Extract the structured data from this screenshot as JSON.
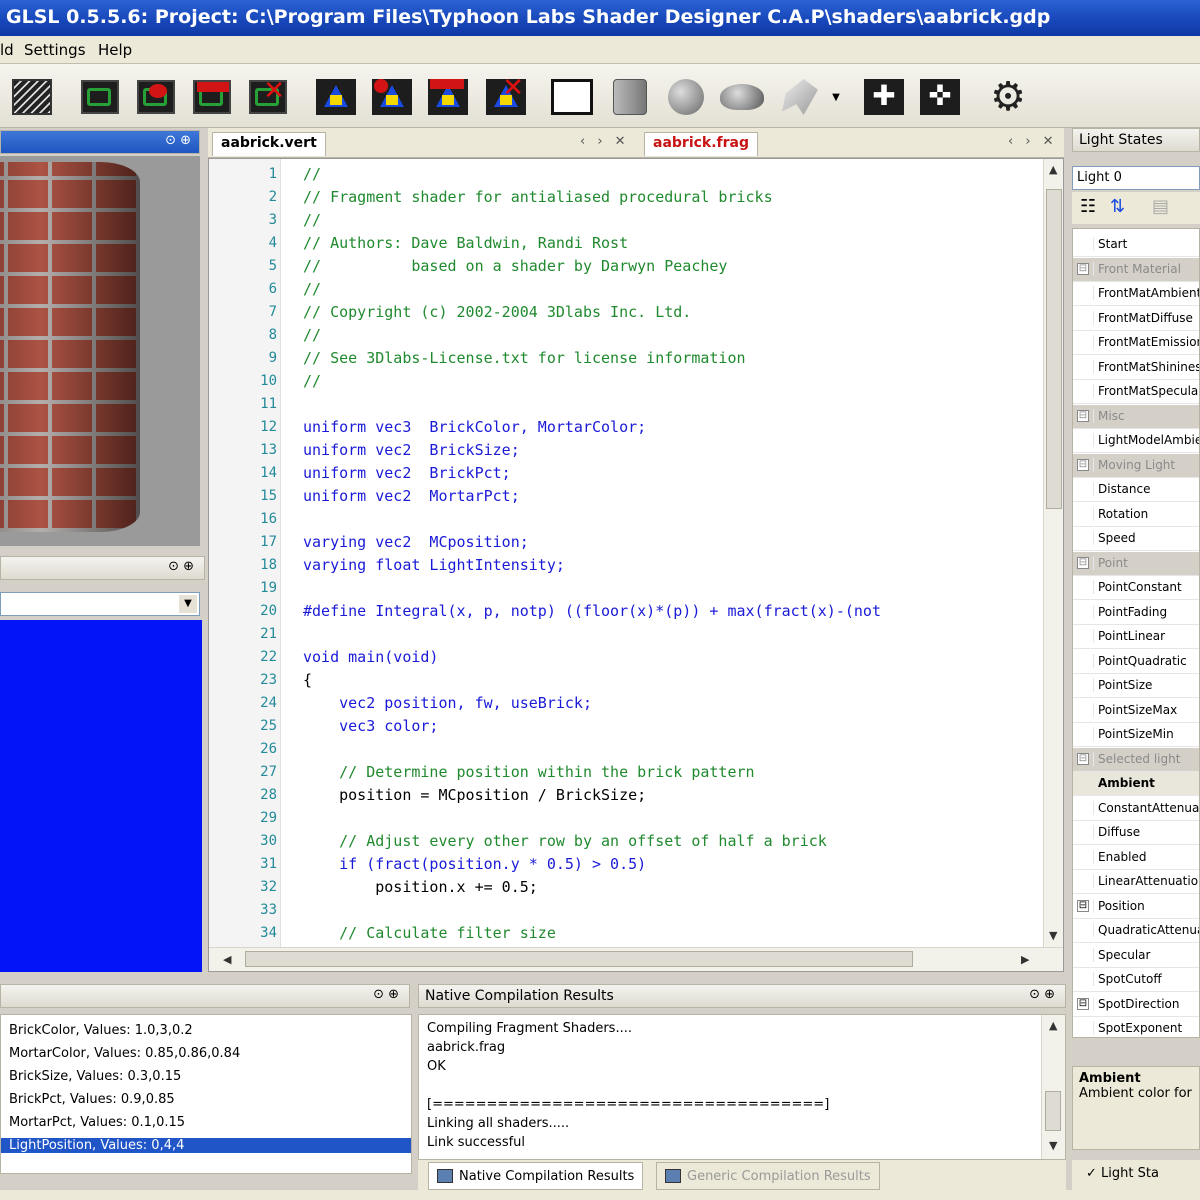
{
  "window": {
    "title": "GLSL 0.5.5.6: Project: C:\\Program Files\\Typhoon Labs Shader Designer C.A.P\\shaders\\aabrick.gdp"
  },
  "menu": {
    "items": [
      "ld",
      "Settings",
      "Help"
    ]
  },
  "toolbar": {
    "icons": [
      "wireframe-icon",
      "vertex-shader-icon",
      "add-vertex-shader-icon",
      "remove-vertex-shader-icon",
      "delete-vertex-shader-icon",
      "fragment-shader-icon",
      "add-fragment-shader-icon",
      "remove-fragment-shader-icon",
      "delete-fragment-shader-icon",
      "plane-icon",
      "cube-icon",
      "sphere-icon",
      "teapot-icon",
      "model-icon",
      "zoom-in-icon",
      "zoom-out-icon",
      "compile-gear-icon"
    ]
  },
  "editor": {
    "tabs": [
      {
        "label": "aabrick.vert",
        "active": false
      },
      {
        "label": "aabrick.frag",
        "active": true
      }
    ],
    "lines": [
      "//",
      "// Fragment shader for antialiased procedural bricks",
      "//",
      "// Authors: Dave Baldwin, Randi Rost",
      "//          based on a shader by Darwyn Peachey",
      "//",
      "// Copyright (c) 2002-2004 3Dlabs Inc. Ltd.",
      "//",
      "// See 3Dlabs-License.txt for license information",
      "//",
      "",
      "uniform vec3  BrickColor, MortarColor;",
      "uniform vec2  BrickSize;",
      "uniform vec2  BrickPct;",
      "uniform vec2  MortarPct;",
      "",
      "varying vec2  MCposition;",
      "varying float LightIntensity;",
      "",
      "#define Integral(x, p, notp) ((floor(x)*(p)) + max(fract(x)-(not",
      "",
      "void main(void)",
      "{",
      "    vec2 position, fw, useBrick;",
      "    vec3 color;",
      "",
      "    // Determine position within the brick pattern",
      "    position = MCposition / BrickSize;",
      "",
      "    // Adjust every other row by an offset of half a brick",
      "    if (fract(position.y * 0.5) > 0.5)",
      "        position.x += 0.5;",
      "",
      "    // Calculate filter size"
    ]
  },
  "light_panel": {
    "title": "Light States",
    "selected_light": "Light 0",
    "rows": [
      {
        "kind": "item",
        "label": "Start"
      },
      {
        "kind": "cat",
        "label": "Front Material"
      },
      {
        "kind": "item",
        "label": "FrontMatAmbient"
      },
      {
        "kind": "item",
        "label": "FrontMatDiffuse"
      },
      {
        "kind": "item",
        "label": "FrontMatEmission"
      },
      {
        "kind": "item",
        "label": "FrontMatShininess"
      },
      {
        "kind": "item",
        "label": "FrontMatSpecular"
      },
      {
        "kind": "cat",
        "label": "Misc"
      },
      {
        "kind": "item",
        "label": "LightModelAmbient"
      },
      {
        "kind": "cat",
        "label": "Moving Light"
      },
      {
        "kind": "item",
        "label": "Distance"
      },
      {
        "kind": "item",
        "label": "Rotation"
      },
      {
        "kind": "item",
        "label": "Speed"
      },
      {
        "kind": "cat",
        "label": "Point"
      },
      {
        "kind": "item",
        "label": "PointConstant"
      },
      {
        "kind": "item",
        "label": "PointFading"
      },
      {
        "kind": "item",
        "label": "PointLinear"
      },
      {
        "kind": "item",
        "label": "PointQuadratic"
      },
      {
        "kind": "item",
        "label": "PointSize"
      },
      {
        "kind": "item",
        "label": "PointSizeMax"
      },
      {
        "kind": "item",
        "label": "PointSizeMin"
      },
      {
        "kind": "cat",
        "label": "Selected light"
      },
      {
        "kind": "item",
        "label": "Ambient"
      },
      {
        "kind": "item",
        "label": "ConstantAttenuation"
      },
      {
        "kind": "item",
        "label": "Diffuse"
      },
      {
        "kind": "item",
        "label": "Enabled"
      },
      {
        "kind": "item",
        "label": "LinearAttenuation"
      },
      {
        "kind": "cat2",
        "label": "Position"
      },
      {
        "kind": "item",
        "label": "QuadraticAttenuation"
      },
      {
        "kind": "item",
        "label": "Specular"
      },
      {
        "kind": "item",
        "label": "SpotCutoff"
      },
      {
        "kind": "cat2",
        "label": "SpotDirection"
      },
      {
        "kind": "item",
        "label": "SpotExponent"
      }
    ],
    "description_title": "Ambient",
    "description_text": "Ambient color for",
    "bottom_tab": "Light Sta"
  },
  "uniforms": {
    "items": [
      {
        "text": "BrickColor, Values: 1.0,3,0.2",
        "selected": false
      },
      {
        "text": "MortarColor, Values: 0.85,0.86,0.84",
        "selected": false
      },
      {
        "text": "BrickSize, Values: 0.3,0.15",
        "selected": false
      },
      {
        "text": "BrickPct, Values: 0.9,0.85",
        "selected": false
      },
      {
        "text": "MortarPct, Values: 0.1,0.15",
        "selected": false
      },
      {
        "text": "LightPosition, Values: 0,4,4",
        "selected": true
      }
    ]
  },
  "compilation": {
    "title": "Native Compilation Results",
    "lines": [
      "Compiling Fragment Shaders....",
      "aabrick.frag",
      "OK",
      "",
      "[====================================]",
      "Linking all shaders.....",
      "Link successful"
    ],
    "tabs": [
      "Native Compilation Results",
      "Generic Compilation Results"
    ]
  }
}
